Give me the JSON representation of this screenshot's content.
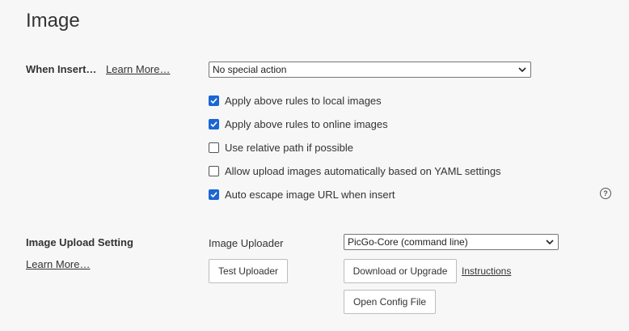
{
  "page": {
    "title": "Image"
  },
  "insert": {
    "label": "When Insert…",
    "learn_more": "Learn More…",
    "select_value": "No special action",
    "options": [
      {
        "label": "Apply above rules to local images",
        "checked": true
      },
      {
        "label": "Apply above rules to online images",
        "checked": true
      },
      {
        "label": "Use relative path if possible",
        "checked": false
      },
      {
        "label": "Allow upload images automatically based on YAML settings",
        "checked": false
      },
      {
        "label": "Auto escape image URL when insert",
        "checked": true
      }
    ],
    "help_glyph": "?"
  },
  "upload": {
    "label": "Image Upload Setting",
    "learn_more": "Learn More…",
    "uploader_label": "Image Uploader",
    "uploader_value": "PicGo-Core (command line)",
    "test_button": "Test Uploader",
    "download_button": "Download or Upgrade",
    "instructions_link": "Instructions",
    "config_button": "Open Config File"
  },
  "colors": {
    "accent": "#1a66d2",
    "background": "#f7f7f7"
  },
  "icons": {
    "checkbox_on": "check-icon",
    "select": "chevron-down-icon",
    "help": "help-circle-icon"
  }
}
